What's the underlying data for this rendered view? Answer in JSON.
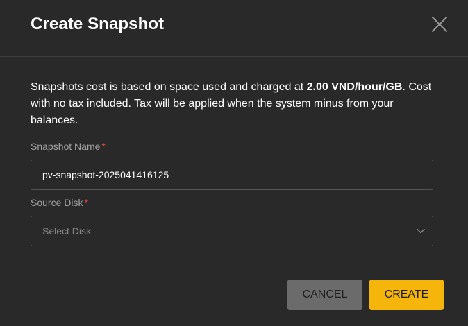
{
  "dialog": {
    "title": "Create Snapshot",
    "close_icon": "close-icon",
    "description": {
      "part1": "Snapshots cost is based on space used and charged at ",
      "price": "2.00 VND/hour/GB",
      "part2": ". Cost with no tax included. Tax will be applied when the system minus from your balances."
    },
    "snapshot_name": {
      "label": "Snapshot Name",
      "required_mark": "*",
      "value": "pv-snapshot-2025041416125"
    },
    "source_disk": {
      "label": "Source Disk",
      "required_mark": "*",
      "placeholder": "Select Disk",
      "icon": "chevron-down-icon"
    },
    "buttons": {
      "cancel": "CANCEL",
      "create": "CREATE"
    }
  },
  "colors": {
    "background": "#292929",
    "accent": "#f5b50a",
    "cancel": "#6b6b6b",
    "required": "#e04848"
  }
}
